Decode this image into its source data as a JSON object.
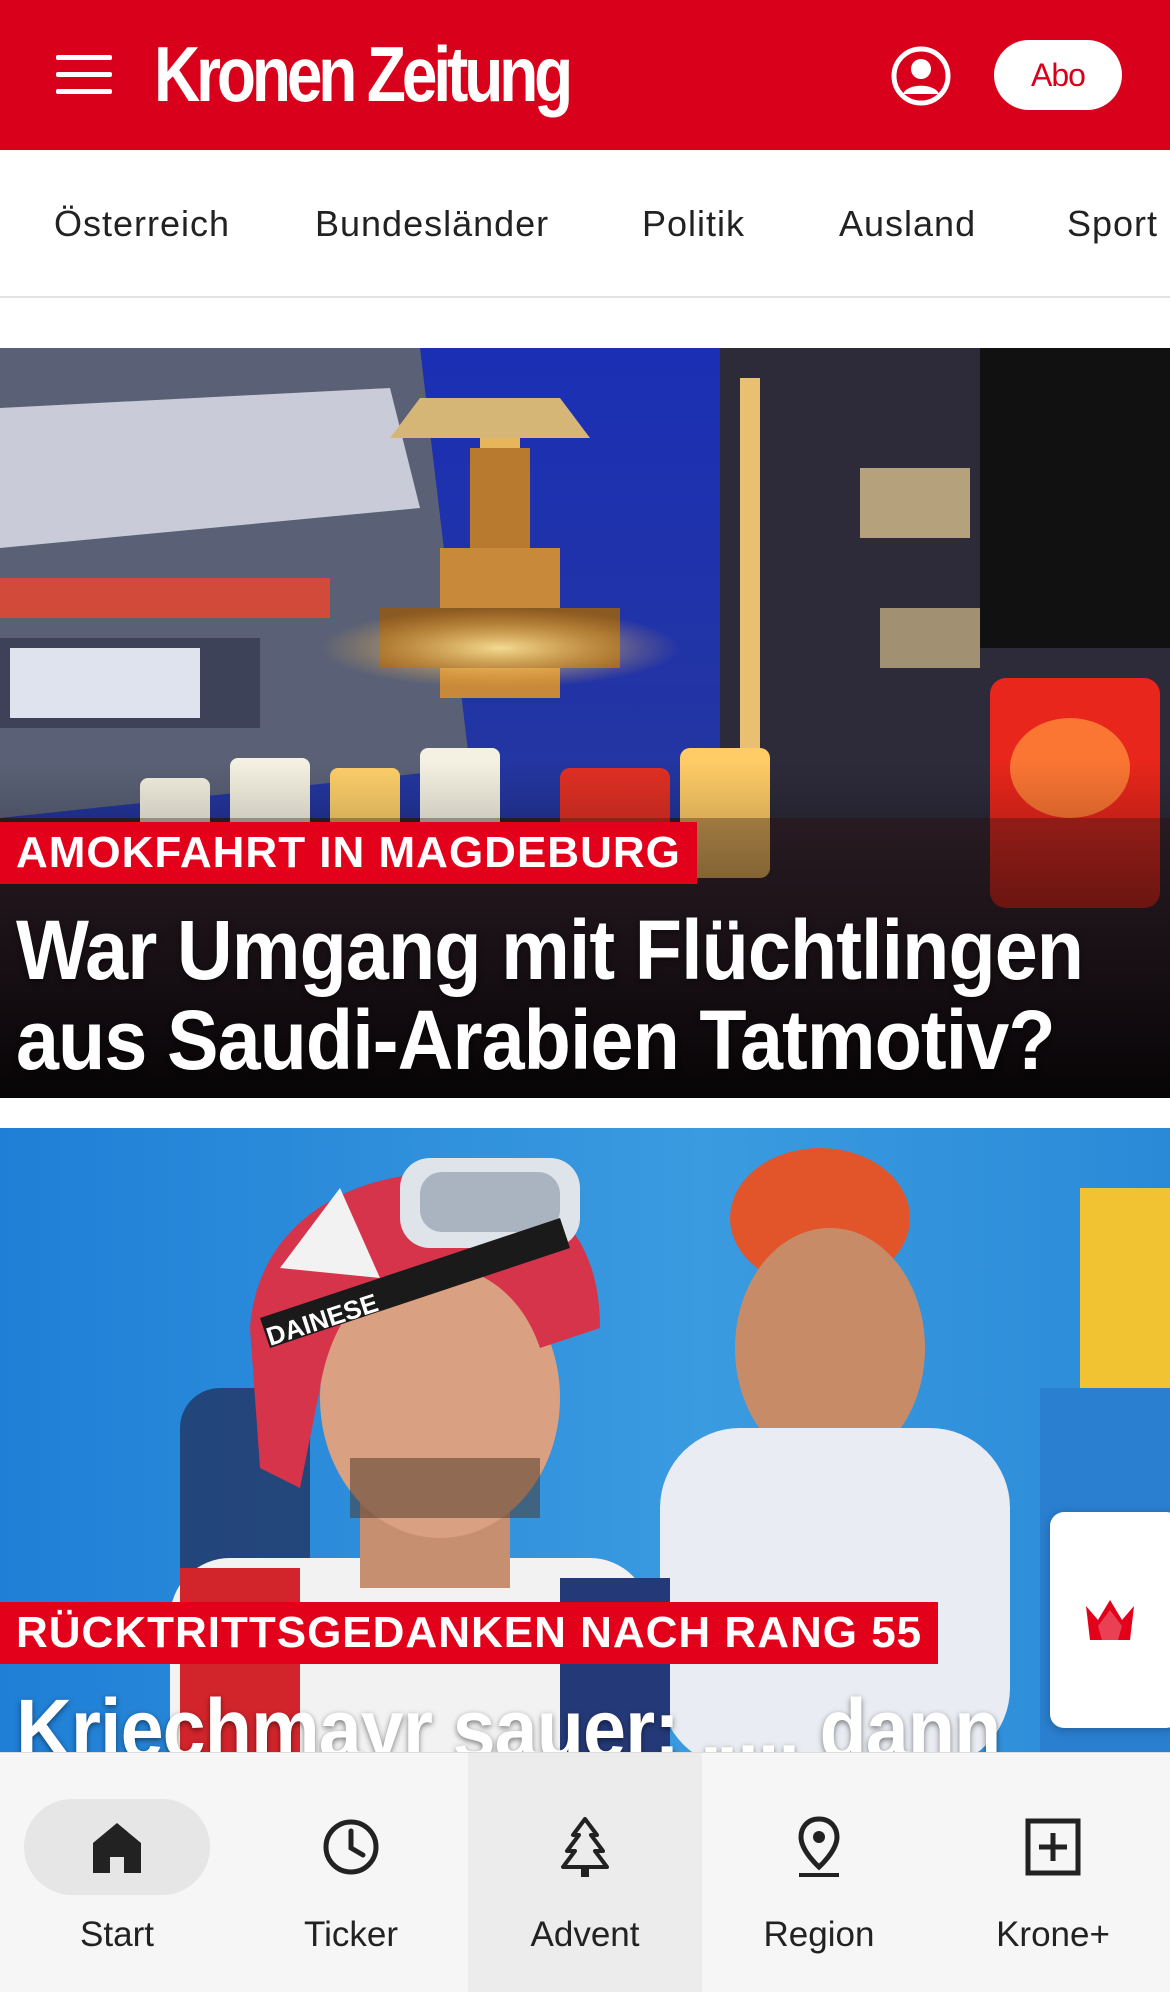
{
  "header": {
    "logo_text": "Kronen Zeitung",
    "abo_label": "Abo",
    "brand_color": "#d9001b",
    "menu_icon": "hamburger-menu-icon",
    "account_icon": "account-icon"
  },
  "sections": [
    "Österreich",
    "Bundesländer",
    "Politik",
    "Ausland",
    "Sport"
  ],
  "teasers": [
    {
      "kicker": "AMOKFAHRT IN MAGDEBURG",
      "headline_line1": "War Umgang mit Flüchtlingen",
      "headline_line2": "aus Saudi-Arabien Tatmotiv?",
      "image": "christmas-market-memorial-candles"
    },
    {
      "kicker": "RÜCKTRITTSGEDANKEN NACH RANG 55",
      "headline_line1": "Kriechmayr sauer: „... dann",
      "image": "skier-with-helmet-and-goggles"
    }
  ],
  "floating_button": {
    "icon": "crown-icon"
  },
  "bottom_nav": [
    {
      "label": "Start",
      "icon": "home-icon",
      "selected": true
    },
    {
      "label": "Ticker",
      "icon": "clock-icon"
    },
    {
      "label": "Advent",
      "icon": "christmas-tree-icon",
      "highlighted": true
    },
    {
      "label": "Region",
      "icon": "location-pin-icon"
    },
    {
      "label": "Krone+",
      "icon": "plus-box-icon"
    }
  ]
}
